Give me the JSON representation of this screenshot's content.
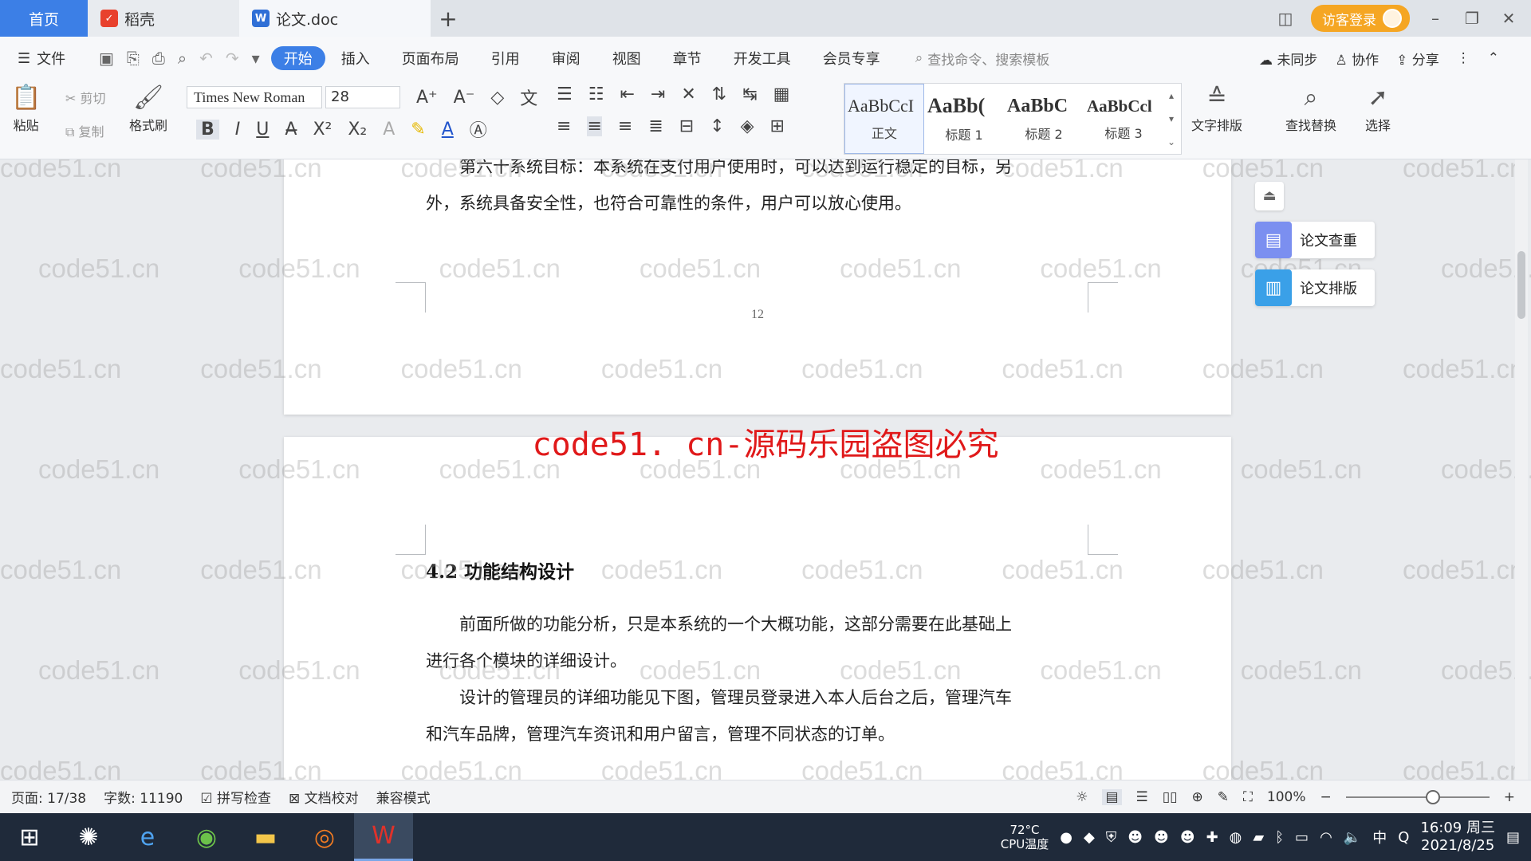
{
  "tabs": {
    "home": "首页",
    "daoke": "稻壳",
    "doc": "论文.doc",
    "add": "+"
  },
  "titlebar": {
    "login": "访客登录"
  },
  "menu": {
    "file": "文件",
    "items": [
      "开始",
      "插入",
      "页面布局",
      "引用",
      "审阅",
      "视图",
      "章节",
      "开发工具",
      "会员专享"
    ],
    "search_placeholder": "查找命令、搜索模板",
    "unsynced": "未同步",
    "collab": "协作",
    "share": "分享"
  },
  "ribbon": {
    "paste": "粘贴",
    "cut": "剪切",
    "copy": "复制",
    "format_painter": "格式刷",
    "font_name": "Times New Roman",
    "font_size": "28",
    "styles": [
      {
        "sample": "AaBbCcI",
        "label": "正文"
      },
      {
        "sample": "AaBb(",
        "label": "标题 1"
      },
      {
        "sample": "AaBbC",
        "label": "标题 2"
      },
      {
        "sample": "AaBbCcl",
        "label": "标题 3"
      }
    ],
    "text_layout": "文字排版",
    "find_replace": "查找替换",
    "select": "选择"
  },
  "document": {
    "page1_line1": "第六十系统目标：本系统在支付用户使用时，可以达到运行稳定的目标，另",
    "page1_line2": "外，系统具备安全性，也符合可靠性的条件，用户可以放心使用。",
    "page_number": "12",
    "heading": "4.2 功能结构设计",
    "para1_line1": "前面所做的功能分析，只是本系统的一个大概功能，这部分需要在此基础上",
    "para1_line2": "进行各个模块的详细设计。",
    "para2_line1": "设计的管理员的详细功能见下图，管理员登录进入本人后台之后，管理汽车",
    "para2_line2": "和汽车品牌，管理汽车资讯和用户留言，管理不同状态的订单。"
  },
  "watermark": {
    "text": "code51.cn",
    "warning": "code51. cn-源码乐园盗图必究"
  },
  "side_panel": {
    "check": "论文查重",
    "layout": "论文排版"
  },
  "status": {
    "page": "页面: 17/38",
    "words": "字数: 11190",
    "spell": "拼写检查",
    "proof": "文档校对",
    "compat": "兼容模式",
    "zoom": "100%"
  },
  "taskbar": {
    "cpu_temp": "72°C",
    "cpu_label": "CPU温度",
    "ime": "中",
    "time": "16:09 周三",
    "date": "2021/8/25"
  },
  "colors": {
    "accent": "#3c7fe6",
    "login": "#f5a623",
    "warning": "#e0191a"
  }
}
